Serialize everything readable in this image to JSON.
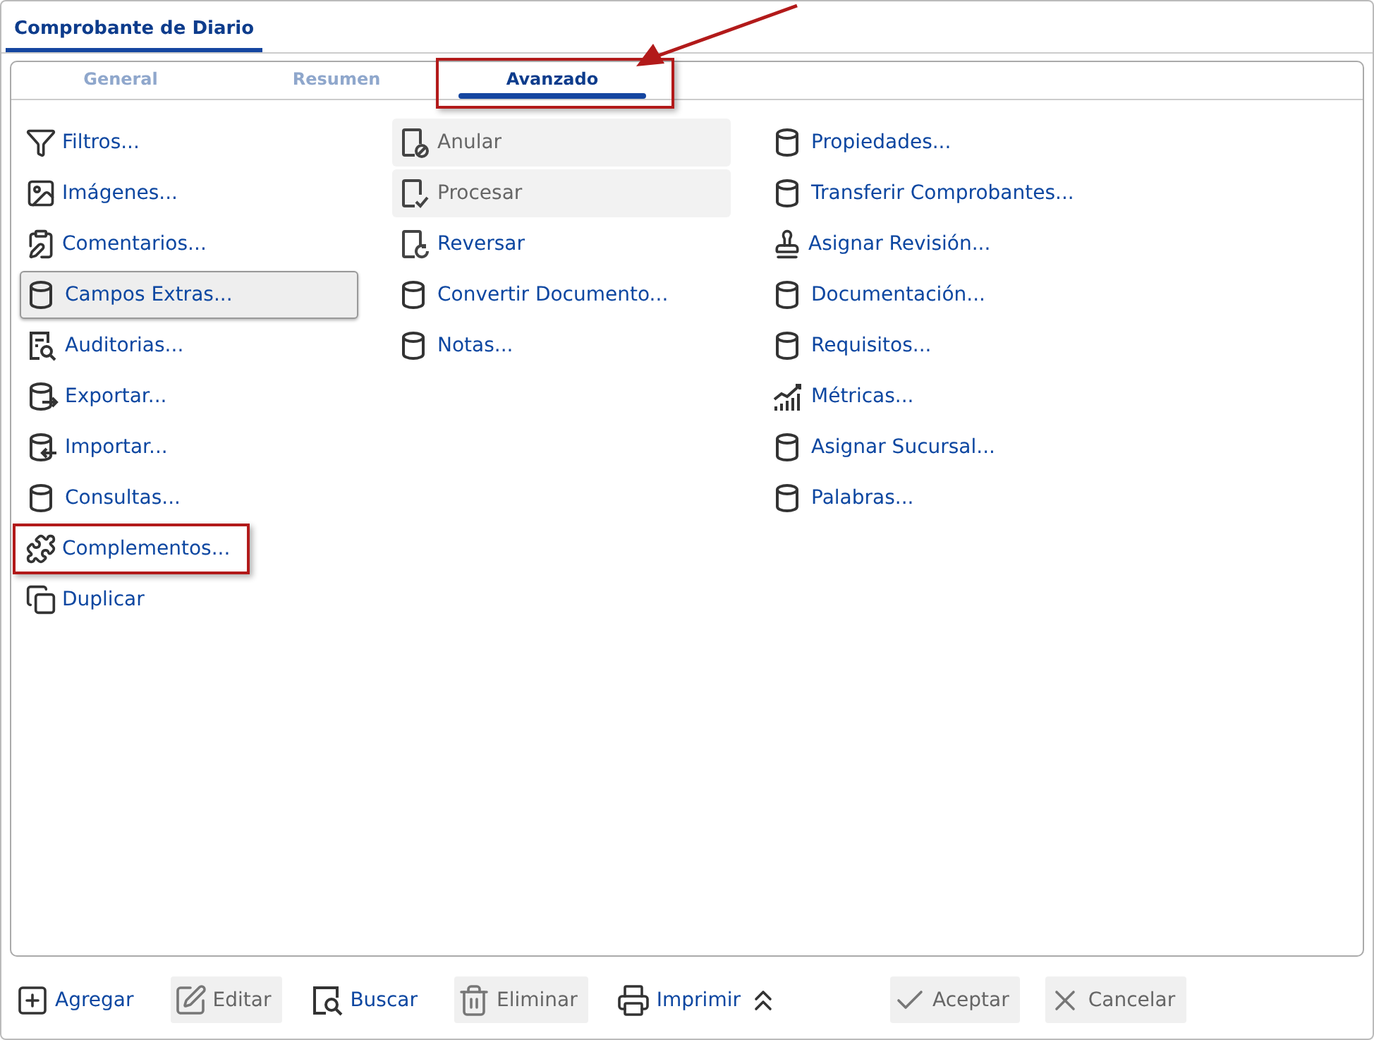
{
  "window": {
    "title": "Comprobante de Diario"
  },
  "tabs": [
    {
      "label": "General",
      "selected": false,
      "annotated": false
    },
    {
      "label": "Resumen",
      "selected": false,
      "annotated": false
    },
    {
      "label": "Avanzado",
      "selected": true,
      "annotated": true
    }
  ],
  "columns": [
    [
      {
        "label": "Filtros...",
        "kind": "funnel",
        "disabled": false,
        "focused": false,
        "annotated": false
      },
      {
        "label": "Imágenes...",
        "kind": "image",
        "disabled": false,
        "focused": false,
        "annotated": false
      },
      {
        "label": "Comentarios...",
        "kind": "clipboard",
        "disabled": false,
        "focused": false,
        "annotated": false
      },
      {
        "label": "Campos Extras...",
        "kind": "database",
        "disabled": false,
        "focused": true,
        "annotated": false
      },
      {
        "label": "Auditorias...",
        "kind": "audit",
        "disabled": false,
        "focused": false,
        "annotated": false
      },
      {
        "label": "Exportar...",
        "kind": "export",
        "disabled": false,
        "focused": false,
        "annotated": false
      },
      {
        "label": "Importar...",
        "kind": "import",
        "disabled": false,
        "focused": false,
        "annotated": false
      },
      {
        "label": "Consultas...",
        "kind": "database",
        "disabled": false,
        "focused": false,
        "annotated": false
      },
      {
        "label": "Complementos...",
        "kind": "puzzle",
        "disabled": false,
        "focused": false,
        "annotated": true
      },
      {
        "label": "Duplicar",
        "kind": "copy",
        "disabled": false,
        "focused": false,
        "annotated": false
      }
    ],
    [
      {
        "label": "Anular",
        "kind": "cancel",
        "disabled": true,
        "focused": false,
        "annotated": false
      },
      {
        "label": "Procesar",
        "kind": "process",
        "disabled": true,
        "focused": false,
        "annotated": false
      },
      {
        "label": "Reversar",
        "kind": "reverse",
        "disabled": false,
        "focused": false,
        "annotated": false
      },
      {
        "label": "Convertir Documento...",
        "kind": "database",
        "disabled": false,
        "focused": false,
        "annotated": false
      },
      {
        "label": "Notas...",
        "kind": "database",
        "disabled": false,
        "focused": false,
        "annotated": false
      }
    ],
    [
      {
        "label": "Propiedades...",
        "kind": "database",
        "disabled": false,
        "focused": false,
        "annotated": false
      },
      {
        "label": "Transferir Comprobantes...",
        "kind": "database",
        "disabled": false,
        "focused": false,
        "annotated": false
      },
      {
        "label": "Asignar Revisión...",
        "kind": "stamp",
        "disabled": false,
        "focused": false,
        "annotated": false
      },
      {
        "label": "Documentación...",
        "kind": "database",
        "disabled": false,
        "focused": false,
        "annotated": false
      },
      {
        "label": "Requisitos...",
        "kind": "database",
        "disabled": false,
        "focused": false,
        "annotated": false
      },
      {
        "label": "Métricas...",
        "kind": "chart",
        "disabled": false,
        "focused": false,
        "annotated": false
      },
      {
        "label": "Asignar Sucursal...",
        "kind": "database",
        "disabled": false,
        "focused": false,
        "annotated": false
      },
      {
        "label": "Palabras...",
        "kind": "database",
        "disabled": false,
        "focused": false,
        "annotated": false
      }
    ]
  ],
  "toolbar": [
    {
      "kind": "add",
      "label": "Agregar",
      "disabled": false
    },
    {
      "kind": "edit",
      "label": "Editar",
      "disabled": true
    },
    {
      "kind": "search",
      "label": "Buscar",
      "disabled": false
    },
    {
      "kind": "trash",
      "label": "Eliminar",
      "disabled": true
    },
    {
      "kind": "print",
      "label": "Imprimir",
      "disabled": false
    },
    {
      "kind": "collapse",
      "disabled": false
    }
  ],
  "dialog_buttons": [
    {
      "kind": "check",
      "label": "Aceptar",
      "disabled": true
    },
    {
      "kind": "close",
      "label": "Cancelar",
      "disabled": true
    }
  ]
}
